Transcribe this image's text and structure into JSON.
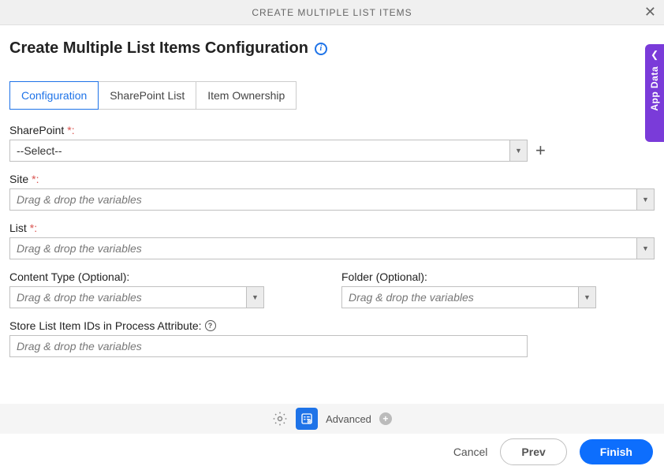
{
  "header": {
    "title": "CREATE MULTIPLE LIST ITEMS"
  },
  "page": {
    "title": "Create Multiple List Items Configuration"
  },
  "tabs": [
    {
      "label": "Configuration"
    },
    {
      "label": "SharePoint List"
    },
    {
      "label": "Item Ownership"
    }
  ],
  "fields": {
    "sharepoint": {
      "label": "SharePoint",
      "value": "--Select--"
    },
    "site": {
      "label": "Site",
      "placeholder": "Drag & drop the variables"
    },
    "list": {
      "label": "List",
      "placeholder": "Drag & drop the variables"
    },
    "contentType": {
      "label": "Content Type (Optional):",
      "placeholder": "Drag & drop the variables"
    },
    "folder": {
      "label": "Folder (Optional):",
      "placeholder": "Drag & drop the variables"
    },
    "storeIds": {
      "label": "Store List Item IDs in Process Attribute:",
      "placeholder": "Drag & drop the variables"
    }
  },
  "toolbar": {
    "advanced": "Advanced"
  },
  "footer": {
    "cancel": "Cancel",
    "prev": "Prev",
    "finish": "Finish"
  },
  "sidetab": {
    "label": "App Data"
  },
  "colors": {
    "accent": "#1e73e8",
    "primary": "#0d6efd",
    "purple": "#7a3bd9"
  }
}
